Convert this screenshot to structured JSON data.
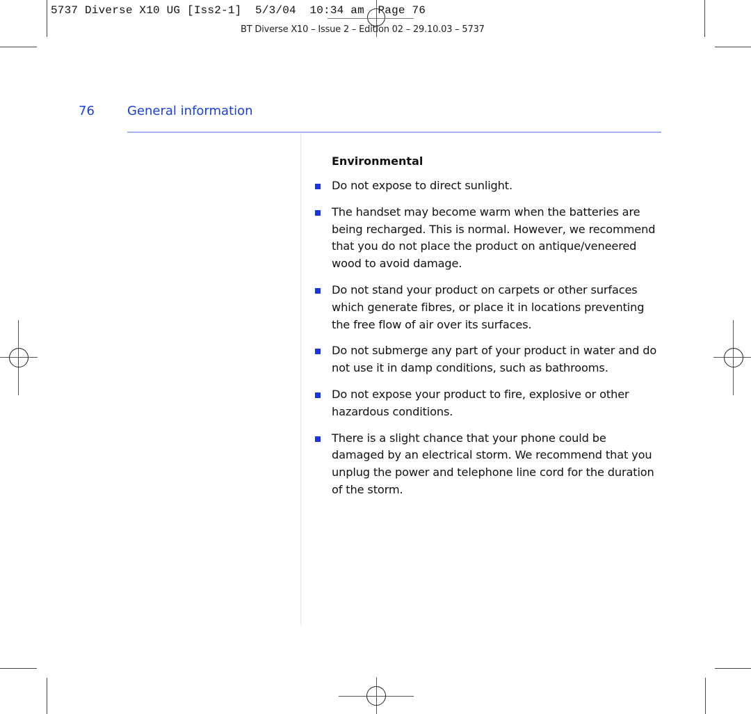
{
  "slug": {
    "line": "5737 Diverse X10 UG [Iss2-1]  5/3/04  10:34 am  Page 76",
    "subline": "BT Diverse X10 – Issue 2 – Edition 02 – 29.10.03 – 5737"
  },
  "running_head": {
    "page_number": "76",
    "section_title": "General information"
  },
  "content": {
    "heading": "Environmental",
    "bullets": [
      "Do not expose to direct sunlight.",
      "The handset may become warm when the batteries are being recharged. This is normal. However, we recommend that you do not place the product on antique/veneered wood to avoid damage.",
      "Do not stand your product on carpets or other surfaces which generate fibres, or place it in locations preventing the free flow of air over its surfaces.",
      "Do not submerge any part of your product in water and do not use it in damp conditions, such as bathrooms.",
      "Do not expose your product to fire, explosive or other hazardous conditions.",
      "There is a slight chance that your phone could be damaged by an electrical storm. We recommend that you unplug the power and telephone line cord for the duration of the storm."
    ]
  },
  "colors": {
    "accent_blue": "#1a3fd6",
    "bullet_blue": "#1a34e0",
    "rule_blue": "#a8b4f2"
  }
}
